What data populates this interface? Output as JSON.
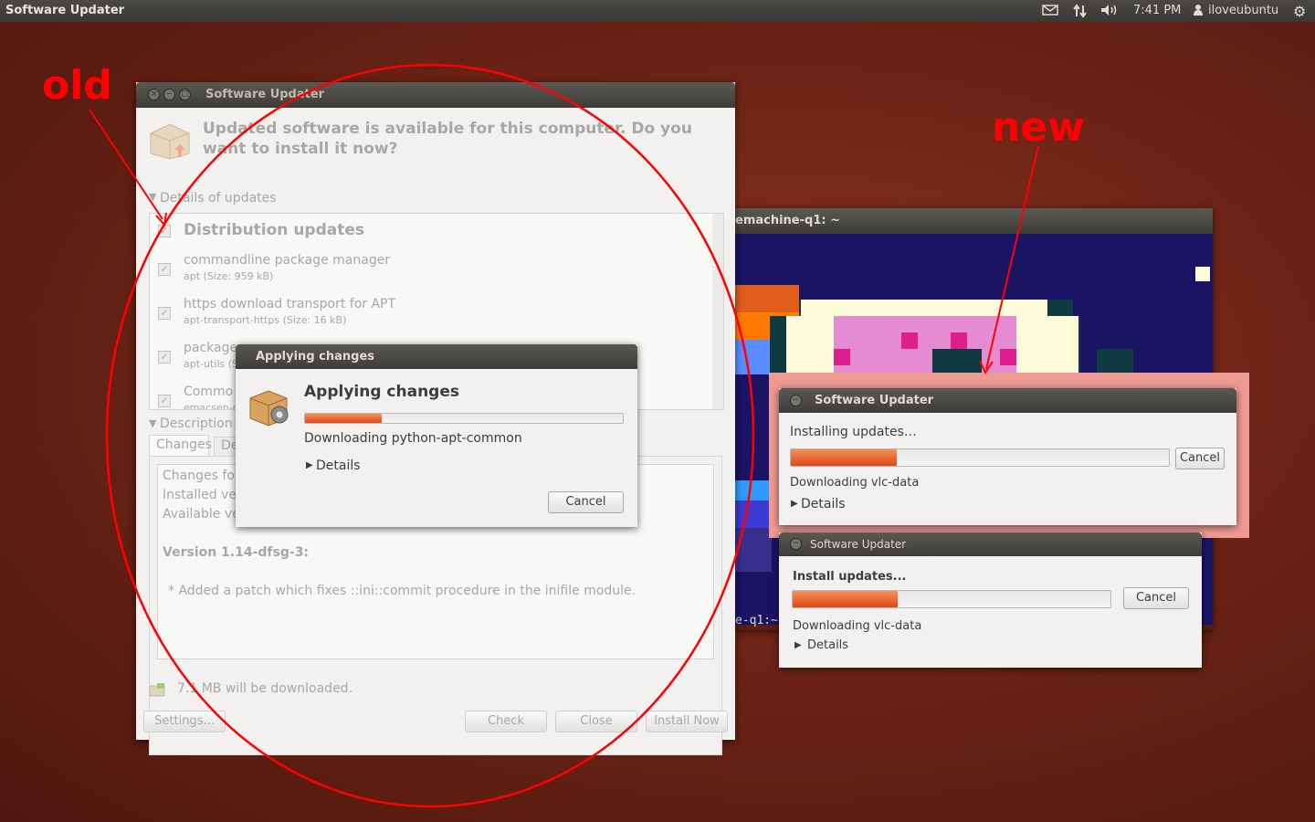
{
  "top_panel": {
    "app_name": "Software Updater",
    "time": "7:41 PM",
    "user": "iloveubuntu",
    "indicators": [
      "mail-icon",
      "network-icon",
      "volume-icon",
      "user-icon",
      "gear-icon"
    ]
  },
  "annotations": {
    "old_label": "old",
    "new_label": "new",
    "color": "#ff0000"
  },
  "old_window": {
    "title": "Software Updater",
    "header": "Updated software is available for this computer. Do you want to install it now?",
    "details_expander": "Details of updates",
    "category": "Distribution updates",
    "packages": [
      {
        "name": "commandline package manager",
        "info": "apt (Size: 959 kB)",
        "checked": true
      },
      {
        "name": "https download transport for APT",
        "info": "apt-transport-https (Size: 16 kB)",
        "checked": true
      },
      {
        "name": "package",
        "info": "apt-utils (S",
        "checked": true
      },
      {
        "name": "Commo",
        "info": "emacsen-c",
        "checked": true
      }
    ],
    "description_expander": "Description",
    "tabs": [
      "Changes",
      "De"
    ],
    "changes_lines": [
      "Changes for",
      "Installed ver",
      "Available ve"
    ],
    "version_line": "Version 1.14-dfsg-3:",
    "change_entry": "* Added a patch which fixes ::ini::commit procedure in the inifile module.",
    "download_size": "7.1 MB will be downloaded.",
    "buttons": {
      "settings": "Settings...",
      "check": "Check",
      "close": "Close",
      "install": "Install Now"
    }
  },
  "applying_dialog": {
    "title": "Applying changes",
    "heading": "Applying changes",
    "progress_fraction": 0.24,
    "status": "Downloading python-apt-common",
    "details": "Details",
    "cancel": "Cancel"
  },
  "terminal": {
    "title": "emachine-q1: ~",
    "prompt": "e-q1:~"
  },
  "new_dialog_1": {
    "title": "Software Updater",
    "heading": "Installing updates…",
    "progress_fraction": 0.28,
    "cancel": "Cancel",
    "status": "Downloading vlc-data",
    "details": "Details"
  },
  "new_dialog_2": {
    "title": "Software Updater",
    "heading": "Install updates...",
    "progress_fraction": 0.33,
    "cancel": "Cancel",
    "status": "Downloading vlc-data",
    "details": "Details"
  }
}
